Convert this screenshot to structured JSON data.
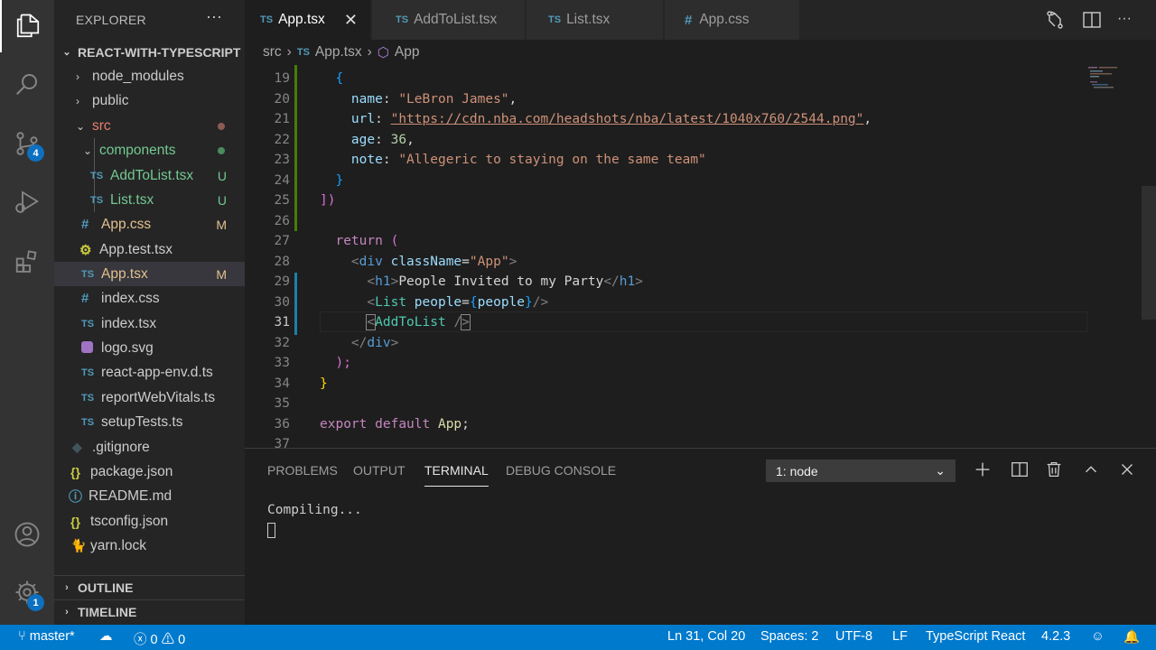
{
  "explorer": {
    "title": "EXPLORER",
    "more": "···",
    "root": "REACT-WITH-TYPESCRIPT",
    "outline": "OUTLINE",
    "timeline": "TIMELINE",
    "tree": [
      {
        "name": "node_modules",
        "type": "folder"
      },
      {
        "name": "public",
        "type": "folder"
      },
      {
        "name": "src",
        "type": "folder-open"
      },
      {
        "name": "components",
        "type": "folder-open"
      },
      {
        "name": "AddToList.tsx",
        "icon": "TS",
        "status": "U"
      },
      {
        "name": "List.tsx",
        "icon": "TS",
        "status": "U"
      },
      {
        "name": "App.css",
        "icon": "#",
        "status": "M"
      },
      {
        "name": "App.test.tsx",
        "icon": "gear"
      },
      {
        "name": "App.tsx",
        "icon": "TS",
        "status": "M"
      },
      {
        "name": "index.css",
        "icon": "#"
      },
      {
        "name": "index.tsx",
        "icon": "TS"
      },
      {
        "name": "logo.svg",
        "icon": "svg"
      },
      {
        "name": "react-app-env.d.ts",
        "icon": "TS"
      },
      {
        "name": "reportWebVitals.ts",
        "icon": "TS"
      },
      {
        "name": "setupTests.ts",
        "icon": "TS"
      },
      {
        "name": ".gitignore",
        "icon": "git"
      },
      {
        "name": "package.json",
        "icon": "{}"
      },
      {
        "name": "README.md",
        "icon": "info"
      },
      {
        "name": "tsconfig.json",
        "icon": "{}"
      },
      {
        "name": "yarn.lock",
        "icon": "yarn"
      }
    ]
  },
  "activity": {
    "scm_badge": "4",
    "settings_badge": "1"
  },
  "tabs": [
    {
      "label": "App.tsx",
      "icon": "TS"
    },
    {
      "label": "AddToList.tsx",
      "icon": "TS"
    },
    {
      "label": "List.tsx",
      "icon": "TS"
    },
    {
      "label": "App.css",
      "icon": "#"
    }
  ],
  "breadcrumb": {
    "folder": "src",
    "file": "App.tsx",
    "symbol": "App",
    "sep": "›",
    "ts": "TS"
  },
  "editor": {
    "line_numbers": [
      "19",
      "20",
      "21",
      "22",
      "23",
      "24",
      "25",
      "26",
      "27",
      "28",
      "29",
      "30",
      "31",
      "32",
      "33",
      "34",
      "35",
      "36",
      "37"
    ],
    "lines": {
      "l19": "{",
      "l20_key": "name",
      "l20_val": "\"LeBron James\"",
      "l21_key": "url",
      "l21_val": "\"https://cdn.nba.com/headshots/nba/latest/1040x760/2544.png\"",
      "l22_key": "age",
      "l22_val": "36",
      "l23_key": "note",
      "l23_val": "\"Allegeric to staying on the same team\"",
      "l24": "}",
      "l25": "])",
      "l27_kw": "return",
      "l27_paren": "(",
      "l28_tag": "div",
      "l28_attr": "className",
      "l28_val": "\"App\"",
      "l29_tag": "h1",
      "l29_text": "People Invited to my Party",
      "l30_tag": "List",
      "l30_attr": "people",
      "l30_var": "people",
      "l31_tag": "AddToList",
      "l32_tag": "div",
      "l33": ");",
      "l34": "}",
      "l36_kw1": "export",
      "l36_kw2": "default",
      "l36_name": "App"
    }
  },
  "panel": {
    "tabs": [
      "PROBLEMS",
      "OUTPUT",
      "TERMINAL",
      "DEBUG CONSOLE"
    ],
    "terminal_select": "1: node",
    "terminal_output": "Compiling..."
  },
  "status": {
    "branch": "master*",
    "errors": "0",
    "warnings": "0",
    "position": "Ln 31, Col 20",
    "spaces": "Spaces: 2",
    "encoding": "UTF-8",
    "eol": "LF",
    "language": "TypeScript React",
    "version": "4.2.3"
  }
}
